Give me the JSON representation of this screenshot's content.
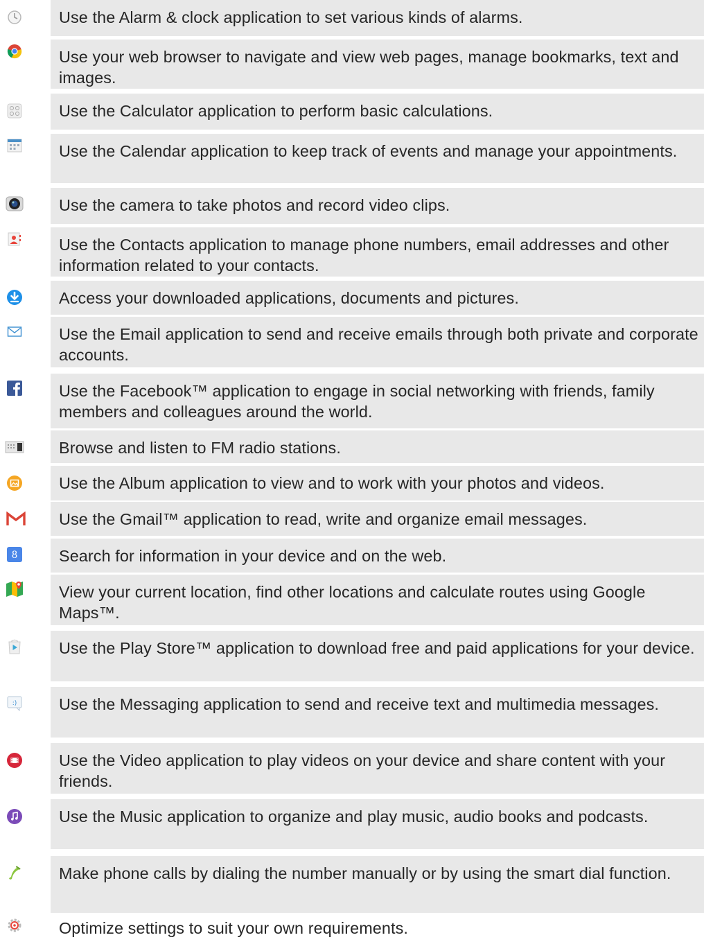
{
  "items": [
    {
      "icon": "alarm-clock-icon",
      "text": "Use the Alarm & clock application to set various kinds of alarms."
    },
    {
      "icon": "chrome-browser-icon",
      "text": "Use your web browser to navigate and view web pages, manage bookmarks, text and images."
    },
    {
      "icon": "calculator-icon",
      "text": "Use the Calculator application to perform basic calculations."
    },
    {
      "icon": "calendar-icon",
      "text": "Use the Calendar application to keep track of events and manage your appointments."
    },
    {
      "icon": "camera-icon",
      "text": "Use the camera to take photos and record video clips."
    },
    {
      "icon": "contacts-icon",
      "text": "Use the Contacts application to manage phone numbers, email addresses and other information related to your contacts."
    },
    {
      "icon": "download-icon",
      "text": "Access your downloaded applications, documents and pictures."
    },
    {
      "icon": "email-icon",
      "text": "Use the Email application to send and receive emails through both private and corporate accounts."
    },
    {
      "icon": "facebook-icon",
      "text": "Use the Facebook™ application to engage in social networking with friends, family members and colleagues around the world."
    },
    {
      "icon": "fm-radio-icon",
      "text": "Browse and listen to FM radio stations."
    },
    {
      "icon": "album-icon",
      "text": "Use the Album application to view and to work with your photos and videos."
    },
    {
      "icon": "gmail-icon",
      "text": "Use the Gmail™ application to read, write and organize email messages."
    },
    {
      "icon": "google-search-icon",
      "text": "Search for information in your device and on the web."
    },
    {
      "icon": "maps-icon",
      "text": "View your current location, find other locations and calculate routes using Google Maps™."
    },
    {
      "icon": "play-store-icon",
      "text": "Use the Play Store™ application to download free and paid applications for your device."
    },
    {
      "icon": "messaging-icon",
      "text": "Use the Messaging application to send and receive text and multimedia messages."
    },
    {
      "icon": "video-icon",
      "text": "Use the Video application to play videos on your device and share content with your friends."
    },
    {
      "icon": "music-icon",
      "text": "Use the Music application to organize and play music, audio books and podcasts."
    },
    {
      "icon": "phone-icon",
      "text": "Make phone calls by dialing the number manually or by using the smart dial function."
    },
    {
      "icon": "settings-icon",
      "text": "Optimize settings to suit your own requirements."
    }
  ]
}
